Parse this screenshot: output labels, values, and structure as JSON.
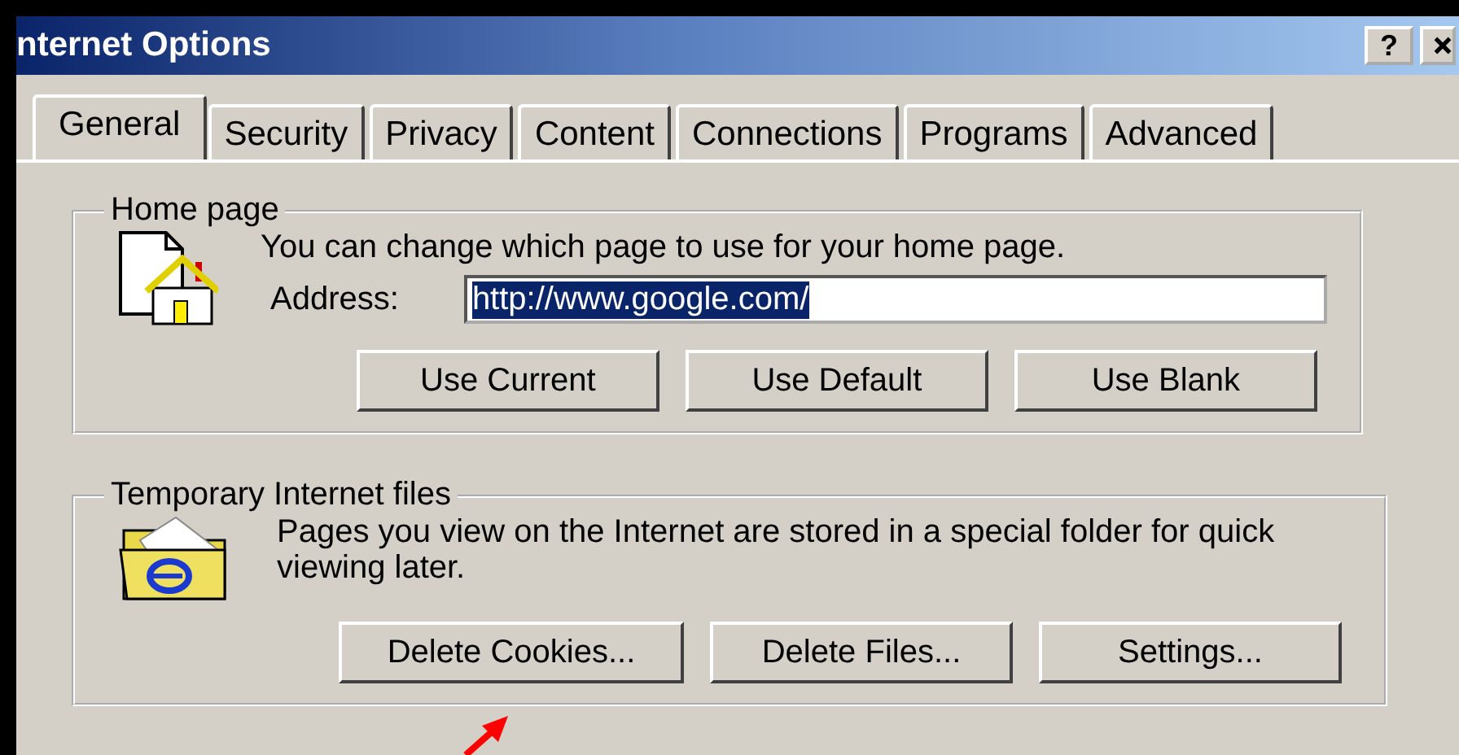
{
  "window": {
    "title": "nternet Options",
    "help_button": "?"
  },
  "tabs": [
    {
      "label": "General",
      "selected": true
    },
    {
      "label": "Security",
      "selected": false
    },
    {
      "label": "Privacy",
      "selected": false
    },
    {
      "label": "Content",
      "selected": false
    },
    {
      "label": "Connections",
      "selected": false
    },
    {
      "label": "Programs",
      "selected": false
    },
    {
      "label": "Advanced",
      "selected": false
    }
  ],
  "home_page": {
    "title": "Home page",
    "description": "You can change which page to use for your home page.",
    "address_label": "Address:",
    "address_value": "http://www.google.com/",
    "address_selected": true,
    "buttons": [
      "Use Current",
      "Use Default",
      "Use Blank"
    ]
  },
  "temporary_files": {
    "title": "Temporary Internet files",
    "description": "Pages you view on the Internet are stored in a special folder for quick viewing later.",
    "buttons": [
      "Delete Cookies...",
      "Delete Files...",
      "Settings..."
    ]
  }
}
